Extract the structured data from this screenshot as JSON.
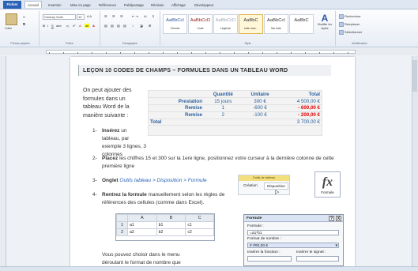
{
  "ribbon": {
    "tabs": [
      "Fichier",
      "Accueil",
      "Insertion",
      "Mise en page",
      "Références",
      "Publipostage",
      "Révision",
      "Affichage",
      "Développeur"
    ],
    "active_tab": "Accueil",
    "paste_label": "Coller",
    "font_name": "Century Goth",
    "font_size": "10",
    "groups": {
      "clipboard": "Presse-papiers",
      "police": "Police",
      "paragraphe": "Paragraphe",
      "style": "Style",
      "modification": "Modification"
    },
    "styles": [
      {
        "sample": "AaBbCcI",
        "name": "Chemin"
      },
      {
        "sample": "AaBbCcD",
        "name": "Code"
      },
      {
        "sample": "AaBbCcD",
        "name": "Legende"
      },
      {
        "sample": "AaBbC",
        "name": "Liste num..."
      },
      {
        "sample": "AaBbCcI",
        "name": "Ma Liste"
      },
      {
        "sample": "AaBbC",
        "name": "Aa"
      }
    ],
    "modify_styles": "Modifier les styles",
    "rechercher": "Rechercher",
    "remplacer": "Remplacer",
    "selectionner": "Sélectionner"
  },
  "doc": {
    "lecon": "LEÇON 10    CODES DE CHAMPS – FORMULES DANS UN TABLEAU WORD",
    "intro": [
      "On peut ajouter des",
      "formules dans un",
      "tableau Word de la",
      "manière suivante :"
    ],
    "table": {
      "headers": [
        "",
        "Quantité",
        "Unitaire",
        "Total"
      ],
      "rows": [
        [
          "Prestation",
          "15 jours",
          "300 €",
          "4 500,00 €"
        ],
        [
          "Remise",
          "1",
          "-600 €",
          "- 600,00 €"
        ],
        [
          "Remise",
          "2",
          "-100 €",
          "- 200,00 €"
        ],
        [
          "Total",
          "",
          "",
          "3 700,00 €"
        ]
      ]
    },
    "steps": [
      {
        "num": "1-",
        "bold": "Insérez",
        "text": "un tableau, par exemple 3 lignes, 3 colonnes"
      },
      {
        "num": "2-",
        "bold": "Placez",
        "text": "les chiffres 15 et 300 sur la 1ere ligne, positionnez votre curseur à la dernière colonne de cette première ligne"
      },
      {
        "num": "3-",
        "bold": "Onglet",
        "link": "Outils tableau > Disposition > Formule"
      },
      {
        "num": "4-",
        "bold": "Rentrez la formule",
        "text": "manuellement selon les règles de références des cellules (comme dans Excel)."
      }
    ],
    "after": [
      "Vous pouvez choisir dans le menu",
      "déroulant le format de nombre que"
    ]
  },
  "ctx": {
    "title": "Outils de tableau",
    "tab1": "Création",
    "tab2": "Disposition"
  },
  "fx": {
    "icon": "fx",
    "label": "Formule"
  },
  "excel": {
    "cols": [
      "",
      "A",
      "B",
      "C"
    ],
    "rows": [
      [
        "1",
        "a1",
        "b1",
        "c1"
      ],
      [
        "2",
        "a2",
        "b2",
        "c2"
      ]
    ]
  },
  "dialog": {
    "title": "Formule",
    "help": "?",
    "close": "X",
    "formula_label": "Formule :",
    "formula_value": "=a1*b1",
    "number_format_label": "Format de nombre :",
    "number_format_value": "# ##0,00 €",
    "insert_function": "Insérer la fonction :",
    "insert_bookmark": "Insérer le signet :"
  },
  "colors": {
    "accent": "#2b579a",
    "negative": "#e00000",
    "header": "#2a5f9e"
  }
}
